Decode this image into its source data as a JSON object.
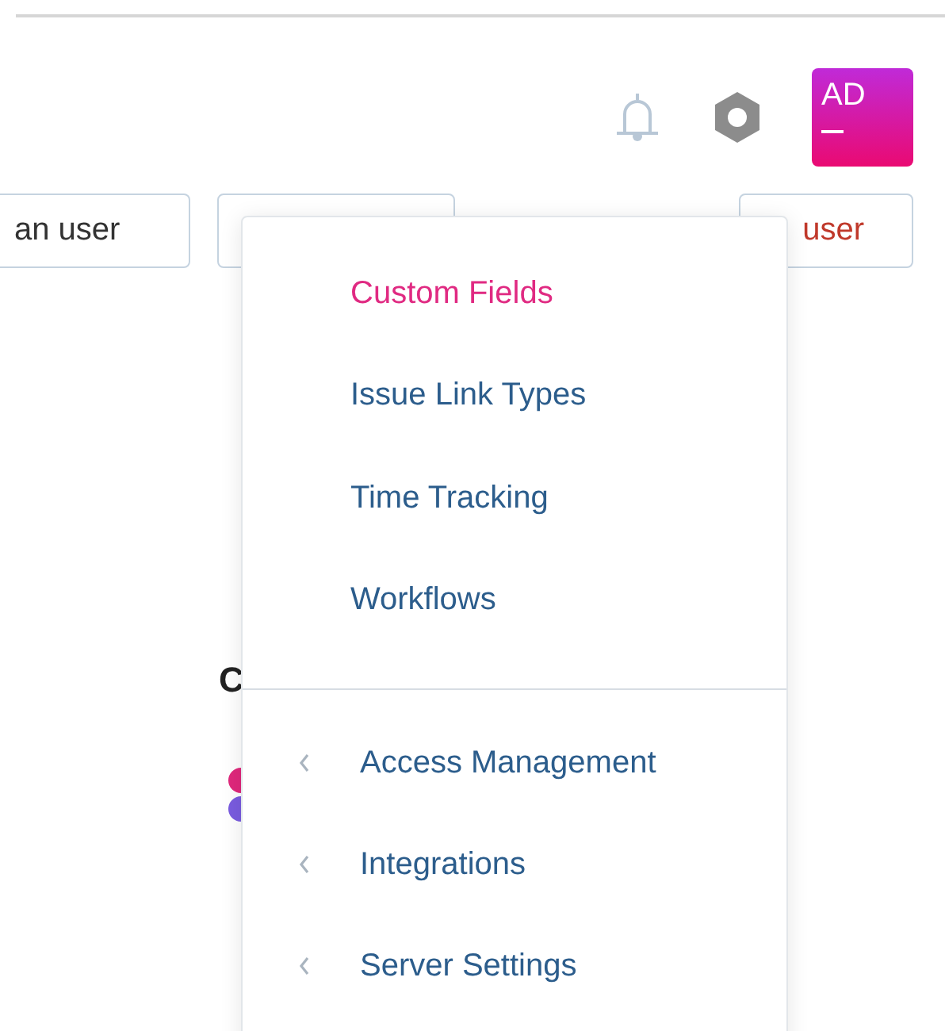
{
  "header": {
    "avatar": {
      "initials": "AD"
    }
  },
  "buttons": [
    {
      "label": "an user",
      "kind": "plain"
    },
    {
      "kind": "plain"
    },
    {
      "label": "user",
      "kind": "danger"
    }
  ],
  "heading": "C",
  "menu": {
    "groups": [
      {
        "items": [
          {
            "label": "Custom Fields",
            "kind": "link",
            "selected": true
          },
          {
            "label": "Issue Link Types",
            "kind": "link",
            "selected": false
          },
          {
            "label": "Time Tracking",
            "kind": "link",
            "selected": false
          },
          {
            "label": "Workflows",
            "kind": "link",
            "selected": false
          }
        ]
      },
      {
        "items": [
          {
            "label": "Access Management",
            "kind": "submenu",
            "selected": false
          },
          {
            "label": "Integrations",
            "kind": "submenu",
            "selected": false
          },
          {
            "label": "Server Settings",
            "kind": "submenu",
            "selected": false
          }
        ]
      }
    ]
  }
}
